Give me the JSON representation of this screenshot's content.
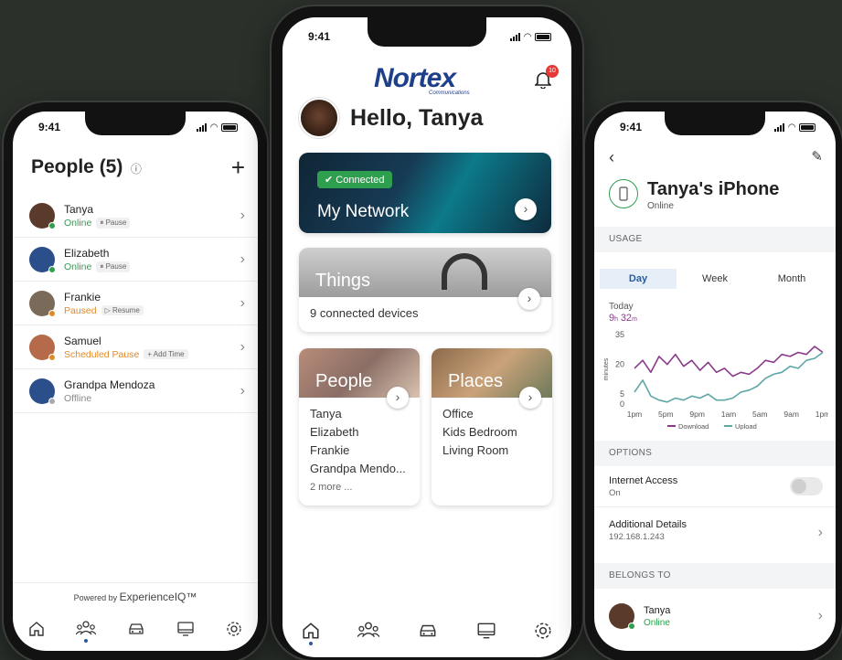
{
  "left": {
    "time": "9:41",
    "title": "People (5)",
    "info_icon": "ⓘ",
    "add_icon": "+",
    "people": [
      {
        "name": "Tanya",
        "status": "Online",
        "status_color": "#2e9e4f",
        "action": "⏸ Pause",
        "avatar_color": "#5a3a2a",
        "dot_color": "#2e9e4f"
      },
      {
        "name": "Elizabeth",
        "status": "Online",
        "status_color": "#2e9e4f",
        "action": "⏸ Pause",
        "avatar_color": "#2a4f8a",
        "dot_color": "#2e9e4f"
      },
      {
        "name": "Frankie",
        "status": "Paused",
        "status_color": "#e08b2a",
        "action": "▷ Resume",
        "avatar_color": "#7a6a5a",
        "dot_color": "#e08b2a"
      },
      {
        "name": "Samuel",
        "status": "Scheduled Pause",
        "status_color": "#e08b2a",
        "action": "+ Add Time",
        "avatar_color": "#b56a4a",
        "dot_color": "#e08b2a"
      },
      {
        "name": "Grandpa Mendoza",
        "status": "Offline",
        "status_color": "#888888",
        "action": "",
        "avatar_color": "#2a4f8a",
        "dot_color": "#aaaaaa"
      }
    ],
    "powered_prefix": "Powered by",
    "powered_brand": "ExperienceIQ™"
  },
  "center": {
    "time": "9:41",
    "brand": "Nortex",
    "brand_sub": "Communications",
    "notification_count": "10",
    "greeting": "Hello, Tanya",
    "network": {
      "badge": "Connected",
      "title": "My Network"
    },
    "things": {
      "title": "Things",
      "subtitle": "9 connected devices"
    },
    "people_card": {
      "title": "People",
      "items": [
        "Tanya",
        "Elizabeth",
        "Frankie",
        "Grandpa Mendo..."
      ],
      "more": "2 more ..."
    },
    "places_card": {
      "title": "Places",
      "items": [
        "Office",
        "Kids Bedroom",
        "Living Room"
      ]
    }
  },
  "right": {
    "time": "9:41",
    "back_icon": "‹",
    "edit_icon": "✎",
    "device_name": "Tanya's iPhone",
    "device_status": "Online",
    "usage_head": "USAGE",
    "tabs": [
      "Day",
      "Week",
      "Month"
    ],
    "today_label": "Today",
    "today_hours": "9",
    "today_h_unit": "h",
    "today_minutes": "32",
    "today_m_unit": "m",
    "options_head": "OPTIONS",
    "internet_access_label": "Internet Access",
    "internet_access_value": "On",
    "details_label": "Additional Details",
    "details_value": "192.168.1.243",
    "belongs_head": "BELONGS TO",
    "owner_name": "Tanya",
    "owner_status": "Online"
  },
  "chart_data": {
    "type": "line",
    "ylabel": "minutes",
    "ylim": [
      0,
      35
    ],
    "yticks": [
      "35",
      "20",
      "5",
      "0"
    ],
    "categories": [
      "1pm",
      "5pm",
      "9pm",
      "1am",
      "5am",
      "9am",
      "1pm"
    ],
    "series": [
      {
        "name": "Download",
        "color": "#8a3a8a",
        "values": [
          18,
          22,
          16,
          24,
          20,
          25,
          19,
          22,
          17,
          21,
          16,
          18,
          14,
          16,
          15,
          18,
          22,
          21,
          25,
          24,
          26,
          25,
          29,
          26
        ]
      },
      {
        "name": "Upload",
        "color": "#5fa7a7",
        "values": [
          6,
          12,
          4,
          2,
          1,
          3,
          2,
          4,
          3,
          5,
          2,
          2,
          3,
          6,
          7,
          9,
          13,
          15,
          16,
          19,
          18,
          22,
          23,
          26
        ]
      }
    ],
    "grid": false,
    "legend": "bottom"
  }
}
